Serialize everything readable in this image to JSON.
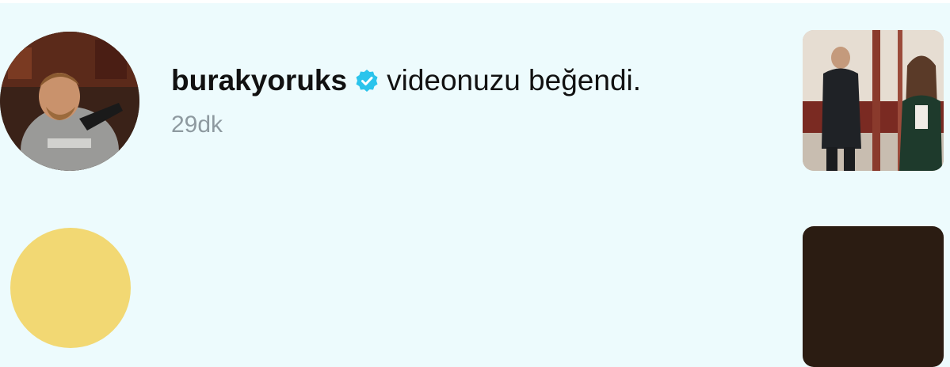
{
  "notifications": [
    {
      "username": "burakyoruks",
      "verified": true,
      "action": "videonuzu beğendi.",
      "time": "29dk",
      "avatar": "user-photo-avatar",
      "thumbnail": "liked-video-thumbnail"
    }
  ],
  "colors": {
    "background": "#edfbfd",
    "verified_badge": "#2bc4ec",
    "text_primary": "#111111",
    "text_secondary": "#8e9aa0"
  }
}
